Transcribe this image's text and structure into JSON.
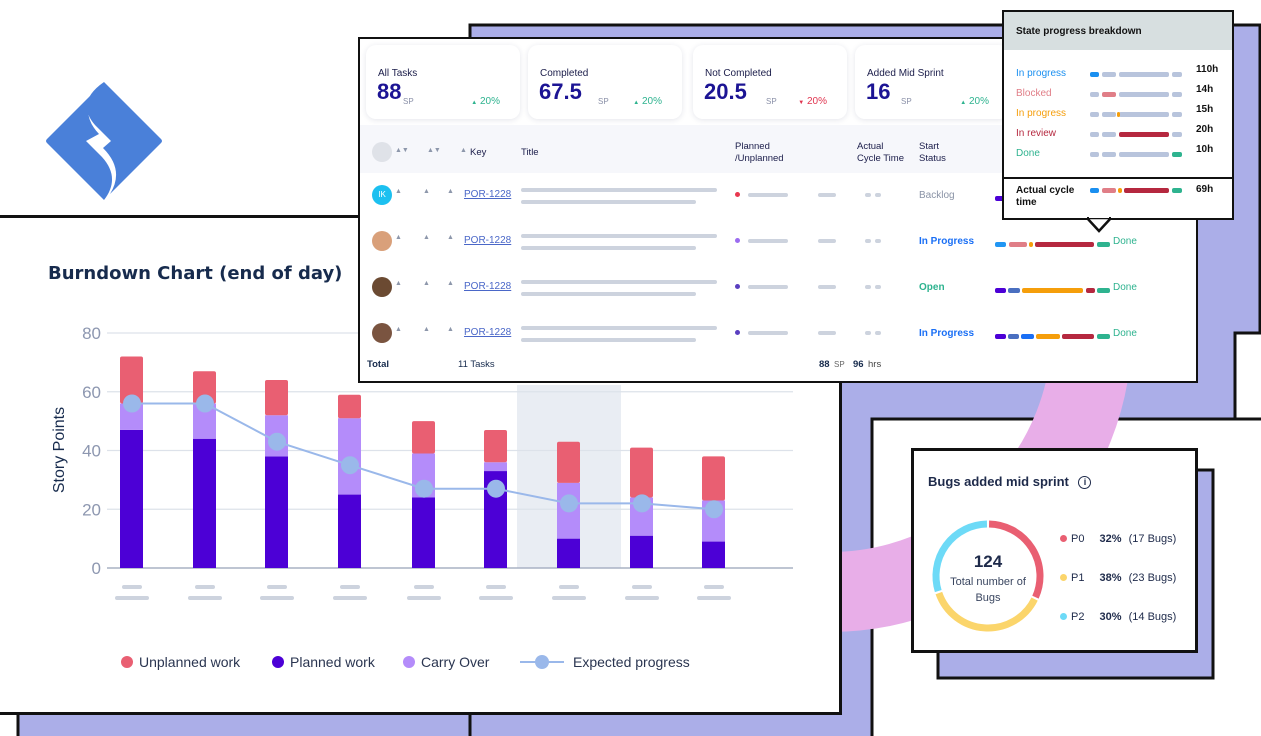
{
  "logo": {
    "name": "jira-logo",
    "color": "#4a80d9"
  },
  "colors": {
    "purple_bg": "#abaee8",
    "pink_band": "#e8aee8",
    "unplanned": "#e95f72",
    "planned": "#4c00d6",
    "carry_over": "#b48cfa",
    "expected": "#9ab8ea"
  },
  "burndown": {
    "title": "Burndown Chart (end of day)",
    "legend": [
      "Unplanned work",
      "Planned work",
      "Carry Over",
      "Expected progress"
    ]
  },
  "chart_data": {
    "type": "bar",
    "title": "Burndown Chart (end of day)",
    "ylabel": "Story Points",
    "ylim": [
      0,
      80
    ],
    "yticks": [
      "0",
      "20",
      "40",
      "60",
      "80"
    ],
    "grid": true,
    "legend_position": "bottom",
    "categories": [
      "",
      "",
      "",
      "",
      "",
      "",
      "",
      "",
      ""
    ],
    "highlighted_category_index": 6,
    "series": [
      {
        "name": "Planned work",
        "type": "stacked-bar",
        "values": [
          47,
          44,
          38,
          25,
          24,
          33,
          10,
          11,
          9
        ]
      },
      {
        "name": "Carry Over",
        "type": "stacked-bar",
        "values": [
          9,
          12,
          14,
          26,
          15,
          3,
          19,
          13,
          14
        ]
      },
      {
        "name": "Unplanned work",
        "type": "stacked-bar",
        "values": [
          16,
          11,
          12,
          8,
          11,
          11,
          14,
          17,
          15
        ]
      },
      {
        "name": "Expected progress",
        "type": "line",
        "values": [
          56,
          56,
          43,
          35,
          27,
          27,
          22,
          22,
          20
        ]
      }
    ]
  },
  "stats": [
    {
      "label": "All Tasks",
      "value": "88",
      "unit": "SP",
      "change": "20%",
      "trend": "up",
      "color": "#2eb38f"
    },
    {
      "label": "Completed",
      "value": "67.5",
      "unit": "SP",
      "change": "20%",
      "trend": "up",
      "color": "#2eb38f"
    },
    {
      "label": "Not Completed",
      "value": "20.5",
      "unit": "SP",
      "change": "20%",
      "trend": "down",
      "color": "#e0344f"
    },
    {
      "label": "Added Mid Sprint",
      "value": "16",
      "unit": "SP",
      "change": "20%",
      "trend": "up",
      "color": "#2eb38f"
    }
  ],
  "table": {
    "headers": {
      "key": "Key",
      "title": "Title",
      "planned": "Planned\n/Unplanned",
      "cycle": "Actual\nCycle Time",
      "start_status": "Start\nStatus"
    },
    "rows": [
      {
        "avatar": "IK",
        "avatar_color": "#1cc0f0",
        "key": "POR-1228",
        "dot": "#e8384f",
        "status": "Backlog",
        "status_color": "#8a93a6",
        "done": ""
      },
      {
        "avatar": "",
        "avatar_color": "#d9a07a",
        "key": "POR-1228",
        "dot": "#9b6cf0",
        "status": "In Progress",
        "status_color": "#1a6ff5",
        "done": "Done"
      },
      {
        "avatar": "",
        "avatar_color": "#6b4a32",
        "key": "POR-1228",
        "dot": "#5a3fc0",
        "status": "Open",
        "status_color": "#2eb38f",
        "done": "Done"
      },
      {
        "avatar": "",
        "avatar_color": "#7a5440",
        "key": "POR-1228",
        "dot": "#5a3fc0",
        "status": "In Progress",
        "status_color": "#1a6ff5",
        "done": "Done"
      }
    ],
    "total": {
      "label": "Total",
      "tasks": "11 Tasks",
      "sp": "88",
      "sp_unit": "SP",
      "hrs": "96",
      "hrs_unit": "hrs"
    }
  },
  "tooltip": {
    "title": "State progress breakdown",
    "rows": [
      {
        "label": "In progress",
        "color": "#1a8ff0",
        "value": "110h"
      },
      {
        "label": "Blocked",
        "color": "#e07e87",
        "value": "14h"
      },
      {
        "label": "In progress",
        "color": "#f59e0b",
        "value": "15h"
      },
      {
        "label": "In review",
        "color": "#b5283f",
        "value": "20h"
      },
      {
        "label": "Done",
        "color": "#2eb38f",
        "value": "10h"
      }
    ],
    "total": {
      "label": "Actual cycle time",
      "value": "69h"
    }
  },
  "bugs": {
    "title": "Bugs added mid sprint",
    "info_icon": "info-icon",
    "total": "124",
    "total_label": "Total number of Bugs",
    "items": [
      {
        "name": "P0",
        "percent": "32%",
        "count": "(17 Bugs)",
        "share": 32,
        "color": "#e95f72"
      },
      {
        "name": "P1",
        "percent": "38%",
        "count": "(23 Bugs)",
        "share": 38,
        "color": "#fbd56b"
      },
      {
        "name": "P2",
        "percent": "30%",
        "count": "(14 Bugs)",
        "share": 30,
        "color": "#6ddaf7"
      }
    ]
  }
}
